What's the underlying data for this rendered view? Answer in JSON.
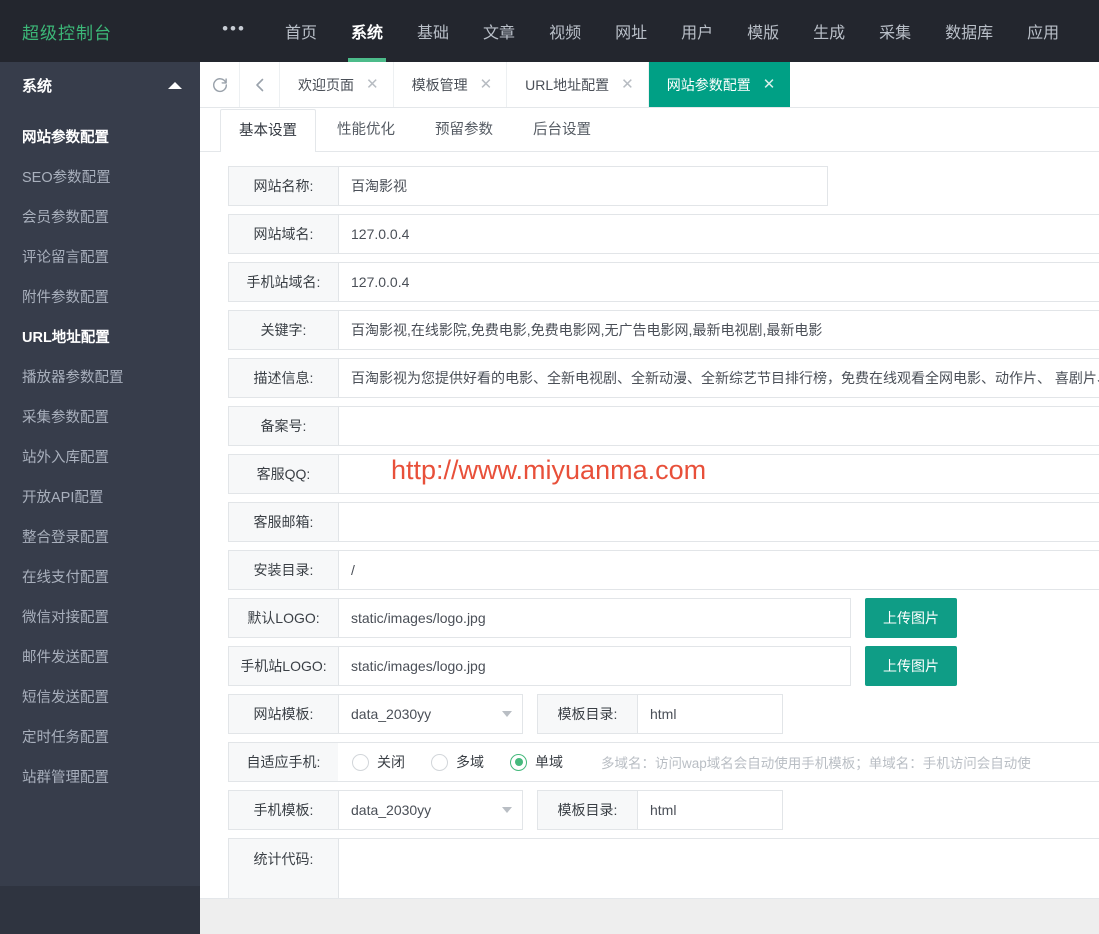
{
  "brand": {
    "title": "超级控制台",
    "more_icon": "•••"
  },
  "topnav": {
    "items": [
      {
        "label": "首页",
        "active": false
      },
      {
        "label": "系统",
        "active": true
      },
      {
        "label": "基础",
        "active": false
      },
      {
        "label": "文章",
        "active": false
      },
      {
        "label": "视频",
        "active": false
      },
      {
        "label": "网址",
        "active": false
      },
      {
        "label": "用户",
        "active": false
      },
      {
        "label": "模版",
        "active": false
      },
      {
        "label": "生成",
        "active": false
      },
      {
        "label": "采集",
        "active": false
      },
      {
        "label": "数据库",
        "active": false
      },
      {
        "label": "应用",
        "active": false
      }
    ]
  },
  "sidebar": {
    "header": "系统",
    "items": [
      {
        "label": "网站参数配置",
        "active": true
      },
      {
        "label": "SEO参数配置",
        "active": false
      },
      {
        "label": "会员参数配置",
        "active": false
      },
      {
        "label": "评论留言配置",
        "active": false
      },
      {
        "label": "附件参数配置",
        "active": false
      },
      {
        "label": "URL地址配置",
        "active": true
      },
      {
        "label": "播放器参数配置",
        "active": false
      },
      {
        "label": "采集参数配置",
        "active": false
      },
      {
        "label": "站外入库配置",
        "active": false
      },
      {
        "label": "开放API配置",
        "active": false
      },
      {
        "label": "整合登录配置",
        "active": false
      },
      {
        "label": "在线支付配置",
        "active": false
      },
      {
        "label": "微信对接配置",
        "active": false
      },
      {
        "label": "邮件发送配置",
        "active": false
      },
      {
        "label": "短信发送配置",
        "active": false
      },
      {
        "label": "定时任务配置",
        "active": false
      },
      {
        "label": "站群管理配置",
        "active": false
      }
    ]
  },
  "tabstrip": {
    "refresh_icon": "refresh",
    "back_icon": "chevron-left",
    "tabs": [
      {
        "label": "欢迎页面",
        "active": false,
        "close": "✕"
      },
      {
        "label": "模板管理",
        "active": false,
        "close": "✕"
      },
      {
        "label": "URL地址配置",
        "active": false,
        "close": "✕"
      },
      {
        "label": "网站参数配置",
        "active": true,
        "close": "✕"
      }
    ]
  },
  "subtabs": [
    {
      "label": "基本设置",
      "active": true
    },
    {
      "label": "性能优化",
      "active": false
    },
    {
      "label": "预留参数",
      "active": false
    },
    {
      "label": "后台设置",
      "active": false
    }
  ],
  "form": {
    "site_name": {
      "label": "网站名称:",
      "value": "百淘影视"
    },
    "site_domain": {
      "label": "网站域名:",
      "value": "127.0.0.4"
    },
    "mobile_domain": {
      "label": "手机站域名:",
      "value": "127.0.0.4"
    },
    "keywords": {
      "label": "关键字:",
      "value": "百淘影视,在线影院,免费电影,免费电影网,无广告电影网,最新电视剧,最新电影"
    },
    "description": {
      "label": "描述信息:",
      "value": "百淘影视为您提供好看的电影、全新电视剧、全新动漫、全新综艺节目排行榜，免费在线观看全网电影、动作片、 喜剧片、"
    },
    "icp": {
      "label": "备案号:",
      "value": ""
    },
    "service_qq": {
      "label": "客服QQ:",
      "value": ""
    },
    "service_email": {
      "label": "客服邮箱:",
      "value": ""
    },
    "install_dir": {
      "label": "安装目录:",
      "value": "/"
    },
    "default_logo": {
      "label": "默认LOGO:",
      "value": "static/images/logo.jpg",
      "button": "上传图片"
    },
    "mobile_logo": {
      "label": "手机站LOGO:",
      "value": "static/images/logo.jpg",
      "button": "上传图片"
    },
    "site_template": {
      "label": "网站模板:",
      "value": "data_2030yy"
    },
    "template_dir": {
      "label": "模板目录:",
      "value": "html"
    },
    "adaptive_mobile": {
      "label": "自适应手机:",
      "options": [
        {
          "label": "关闭",
          "checked": false
        },
        {
          "label": "多域",
          "checked": false
        },
        {
          "label": "单域",
          "checked": true
        }
      ],
      "hint": "多域名：访问wap域名会自动使用手机模板；单域名：手机访问会自动使"
    },
    "mobile_template": {
      "label": "手机模板:",
      "value": "data_2030yy"
    },
    "mobile_template_dir": {
      "label": "模板目录:",
      "value": "html"
    },
    "stat_code": {
      "label": "统计代码:",
      "value": ""
    }
  },
  "watermark": {
    "text": "http://www.miyuanma.com"
  },
  "colors": {
    "brand_green": "#3cb878",
    "accent_teal": "#00a085",
    "upload_btn": "#0f9d86",
    "topbar_bg": "#23262e",
    "sidebar_bg": "#373d4b",
    "radio_checked": "#45b97c",
    "watermark_red": "#e8503a"
  }
}
